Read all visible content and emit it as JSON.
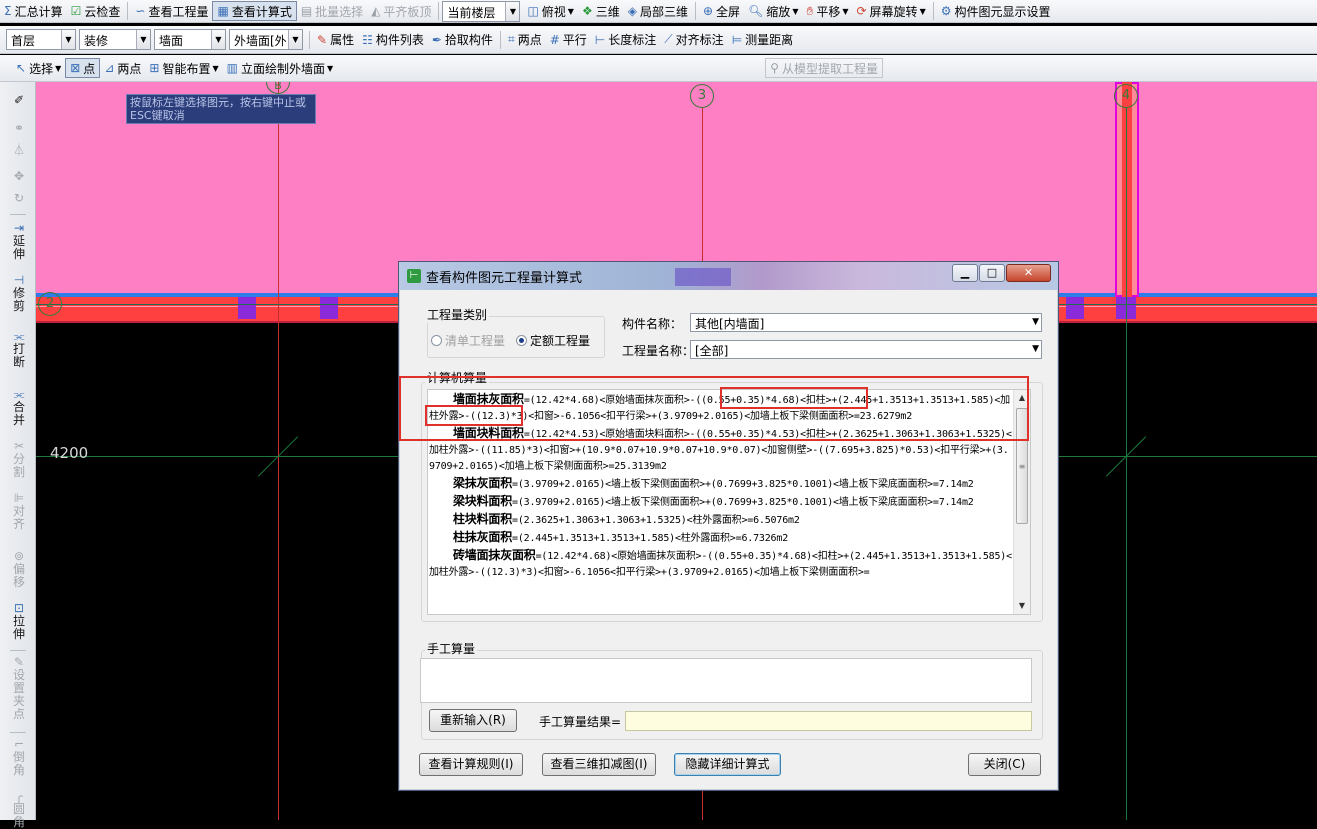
{
  "toolbar1": {
    "summary": "汇总计算",
    "cloud_check": "云检查",
    "view_quantity": "查看工程量",
    "view_formula": "查看计算式",
    "batch_select": "批量选择",
    "align_slab": "平齐板顶",
    "floor_combo": "当前楼层",
    "top_view": "俯视",
    "three_d": "三维",
    "partial_3d": "局部三维",
    "fullscreen": "全屏",
    "zoom": "缩放",
    "pan": "平移",
    "screen_rotate": "屏幕旋转",
    "display_settings": "构件图元显示设置"
  },
  "toolbar2": {
    "floor": "首层",
    "category": "装修",
    "type": "墙面",
    "component": "外墙面[外",
    "properties": "属性",
    "component_list": "构件列表",
    "pick_component": "拾取构件",
    "two_points": "两点",
    "parallel": "平行",
    "length_dim": "长度标注",
    "align_dim": "对齐标注",
    "measure_distance": "测量距离"
  },
  "toolbar3": {
    "select": "选择",
    "point": "点",
    "two_points": "两点",
    "smart_layout": "智能布置",
    "elevation_draw": "立面绘制外墙面",
    "extract_from_model": "从模型提取工程量"
  },
  "leftbar": {
    "extend": "延伸",
    "trim": "修剪",
    "break": "打断",
    "merge": "合并",
    "split": "分割",
    "align": "对齐",
    "offset": "偏移",
    "stretch": "拉伸",
    "set_grip": "设置夹点",
    "chamfer": "倒角",
    "fillet": "圆角"
  },
  "canvas": {
    "hint": "按鼠标左键选择图元，按右键中止或ESC键取消",
    "axis_3": "3",
    "axis_4": "4",
    "axis_2": "2",
    "axis_b": "B",
    "dimension": "4200",
    "colors": {
      "wall_fill": "#ff7fc4",
      "wall_band": "#ff4040",
      "axis": "#1e7a3c",
      "highlight": "#e000e0"
    }
  },
  "dialog": {
    "title": "查看构件图元工程量计算式",
    "quantity_type_group": "工程量类别",
    "option_list_quantity": "清单工程量",
    "option_norm_quantity": "定额工程量",
    "selected_option": "定额工程量",
    "component_name_label": "构件名称：",
    "component_name_value": "其他[内墙面]",
    "quantity_name_label": "工程量名称：",
    "quantity_name_value": "[全部]",
    "computer_calc_label": "计算机算量",
    "formula_lines": [
      {
        "name": "墙面抹灰面积",
        "expr": "=(12.42*4.68)<原始墙面抹灰面积>-((0.55+0.35)*4.68)<扣柱>+(2.445+1.3513+1.3513+1.585)<加柱外露>-((12.3)*3)<扣窗>-6.1056<扣平行梁>+(3.9709+2.0165)<加墙上板下梁侧面面积>=23.6279m2"
      },
      {
        "name": "墙面块料面积",
        "expr": "=(12.42*4.53)<原始墙面块料面积>-((0.55+0.35)*4.53)<扣柱>+(2.3625+1.3063+1.3063+1.5325)<加柱外露>-((11.85)*3)<扣窗>+(10.9*0.07+10.9*0.07+10.9*0.07)<加窗侧壁>-((7.695+3.825)*0.53)<扣平行梁>+(3.9709+2.0165)<加墙上板下梁侧面面积>=25.3139m2"
      },
      {
        "name": "梁抹灰面积",
        "expr": "=(3.9709+2.0165)<墙上板下梁侧面面积>+(0.7699+3.825*0.1001)<墙上板下梁底面面积>=7.14m2"
      },
      {
        "name": "梁块料面积",
        "expr": "=(3.9709+2.0165)<墙上板下梁侧面面积>+(0.7699+3.825*0.1001)<墙上板下梁底面面积>=7.14m2"
      },
      {
        "name": "柱块料面积",
        "expr": "=(2.3625+1.3063+1.3063+1.5325)<柱外露面积>=6.5076m2"
      },
      {
        "name": "柱抹灰面积",
        "expr": "=(2.445+1.3513+1.3513+1.585)<柱外露面积>=6.7326m2"
      },
      {
        "name": "砖墙面抹灰面积",
        "expr": "=(12.42*4.68)<原始墙面抹灰面积>-((0.55+0.35)*4.68)<扣柱>+(2.445+1.3513+1.3513+1.585)<加柱外露>-((12.3)*3)<扣窗>-6.1056<扣平行梁>+(3.9709+2.0165)<加墙上板下梁侧面面积>="
      }
    ],
    "manual_calc_label": "手工算量",
    "reinput_button": "重新输入(R)",
    "manual_result_label": "手工算量结果=",
    "manual_result_value": "",
    "view_rules_button": "查看计算规则(I)",
    "view_3d_button": "查看三维扣减图(I)",
    "hide_detail_button": "隐藏详细计算式",
    "close_button": "关闭(C)"
  }
}
